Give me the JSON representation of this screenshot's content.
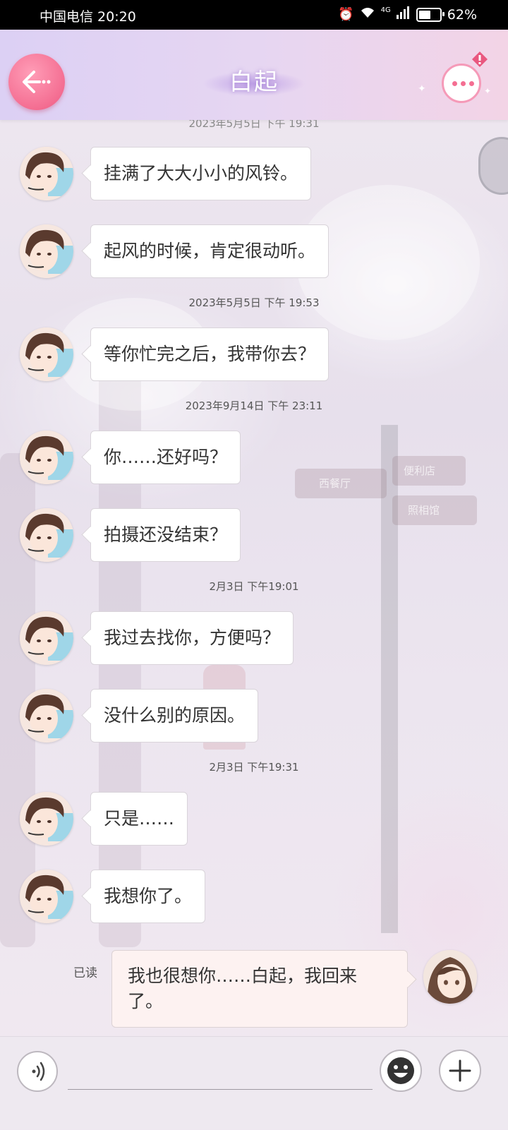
{
  "status_bar": {
    "carrier": "中国电信 20:20",
    "battery": "62%",
    "battery_level": 0.62,
    "network": "4G"
  },
  "header": {
    "title": "白起",
    "back_icon": "back-arrow-icon",
    "more_icon": "more-dots-icon",
    "badge_icon": "alert-badge-icon"
  },
  "chat": {
    "partial_timestamp": "2023年5月5日 下午 19:31",
    "items": [
      {
        "type": "message",
        "text": "挂满了大大小小的风铃。"
      },
      {
        "type": "message",
        "text": "起风的时候，肯定很动听。"
      },
      {
        "type": "timestamp",
        "text": "2023年5月5日  下午 19:53"
      },
      {
        "type": "message",
        "text": "等你忙完之后，我带你去？"
      },
      {
        "type": "timestamp",
        "text": "2023年9月14日  下午 23:11"
      },
      {
        "type": "message",
        "text": "你……还好吗？"
      },
      {
        "type": "message",
        "text": "拍摄还没结束？"
      },
      {
        "type": "timestamp",
        "text": "2月3日  下午19:01"
      },
      {
        "type": "message",
        "text": "我过去找你，方便吗？"
      },
      {
        "type": "message",
        "text": "没什么别的原因。"
      },
      {
        "type": "timestamp",
        "text": "2月3日  下午19:31"
      },
      {
        "type": "message",
        "text": "只是……"
      },
      {
        "type": "message",
        "text": "我想你了。"
      }
    ],
    "my_message": {
      "read_label": "已读",
      "text": "我也很想你……白起，我回来了。"
    }
  },
  "background_signs": [
    "西餐厅",
    "便利店",
    "照相馆"
  ],
  "input_bar": {
    "voice_icon": "voice-icon",
    "emoji_icon": "emoji-icon",
    "plus_icon": "plus-icon"
  },
  "colors": {
    "accent_pink": "#f46e92",
    "header_gradient_left": "#dcd0f4",
    "header_gradient_right": "#f3d4e6",
    "bubble_bg": "#ffffff",
    "my_bubble_bg": "#fdf2f1"
  }
}
